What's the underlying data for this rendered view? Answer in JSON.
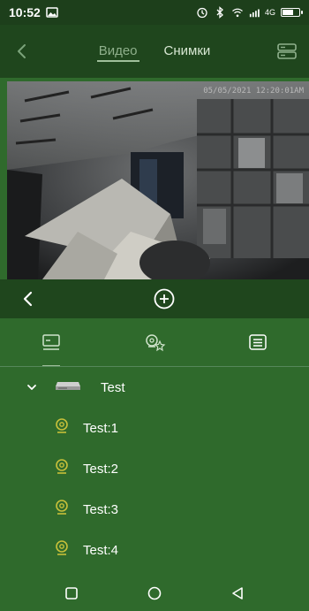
{
  "status_bar": {
    "time": "10:52",
    "icons": [
      "gallery-icon",
      "alarm-icon",
      "bluetooth-icon",
      "wifi-icon",
      "signal-icon",
      "battery-icon"
    ],
    "network_label": "4G"
  },
  "header": {
    "back_icon": "back-chevron-icon",
    "tabs": [
      {
        "label": "Видео",
        "active": true
      },
      {
        "label": "Снимки",
        "active": false
      }
    ],
    "right_icon": "device-stack-icon"
  },
  "player": {
    "timestamp": "05/05/2021 12:20:01AM"
  },
  "controls": {
    "prev_icon": "chevron-left-icon",
    "add_icon": "add-circle-icon"
  },
  "icon_tabs": [
    {
      "name": "device-list-icon",
      "active": true
    },
    {
      "name": "favorites-icon",
      "active": false
    },
    {
      "name": "menu-list-icon",
      "active": false
    }
  ],
  "device_tree": {
    "device": {
      "label": "Test",
      "expanded": true
    },
    "cameras": [
      {
        "label": "Test:1"
      },
      {
        "label": "Test:2"
      },
      {
        "label": "Test:3"
      },
      {
        "label": "Test:4"
      }
    ]
  },
  "nav": {
    "buttons": [
      "recent-apps-icon",
      "home-icon",
      "back-icon"
    ]
  },
  "colors": {
    "background": "#2f6a2c",
    "header": "#1f461d",
    "status_bar": "#1d3f1b",
    "accent": "#9fbf9a"
  }
}
